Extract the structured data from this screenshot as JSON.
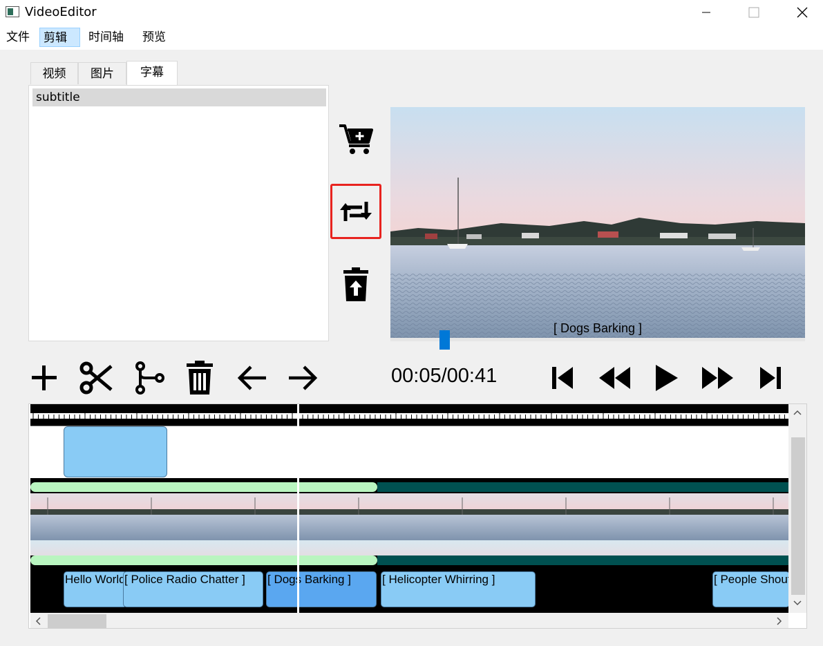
{
  "window": {
    "title": "VideoEditor"
  },
  "menu": [
    "文件",
    "剪辑",
    "时间轴",
    "预览"
  ],
  "tabs": [
    "视频",
    "图片",
    "字幕"
  ],
  "library": {
    "items": [
      "subtitle"
    ]
  },
  "preview": {
    "caption": "[ Dogs Barking ]",
    "seek_fraction": 0.13
  },
  "timecode": "00:05/00:41",
  "subtitles": [
    {
      "text": "Hello World"
    },
    {
      "text": "[ Police Radio Chatter ]"
    },
    {
      "text": "[ Dogs Barking ]"
    },
    {
      "text": "[ Helicopter Whirring ]"
    },
    {
      "text": "[ People Shouting ]"
    }
  ],
  "colors": {
    "accent": "#0078d7",
    "highlight_border": "#e8231f",
    "clip": "#89cbf5",
    "audio_green": "#b9f5c0",
    "audio_teal": "#005050"
  },
  "icons": {
    "side": [
      "cart-plus-icon",
      "replace-icon",
      "trash-upload-icon"
    ],
    "tools": [
      "add-icon",
      "scissors-icon",
      "split-icon",
      "delete-icon",
      "arrow-left-icon",
      "arrow-right-icon"
    ],
    "playback": [
      "skip-start-icon",
      "rewind-icon",
      "play-icon",
      "fast-forward-icon",
      "skip-end-icon"
    ]
  }
}
